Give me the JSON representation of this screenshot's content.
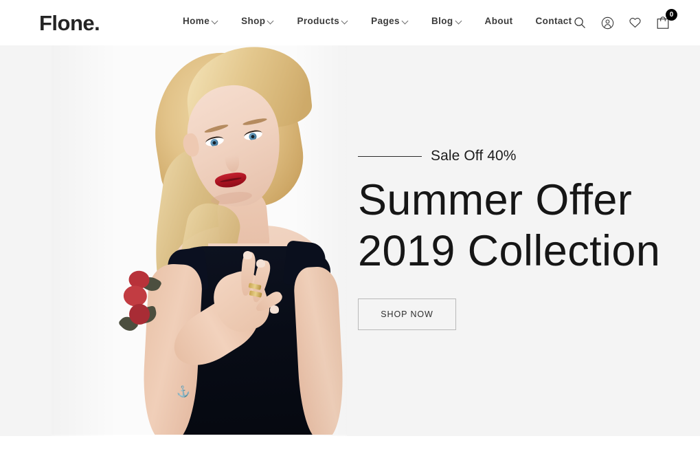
{
  "site": {
    "logo": "Flone.",
    "background_hero": "#f4f4f4",
    "accent": "#000000",
    "text_dark": "#1c1c1c"
  },
  "header": {
    "nav": [
      {
        "label": "Home",
        "has_dropdown": true,
        "caret": "chevron-down-icon"
      },
      {
        "label": "Shop",
        "has_dropdown": true,
        "caret": "chevron-down-icon"
      },
      {
        "label": "Products",
        "has_dropdown": true,
        "caret": "chevron-down-icon"
      },
      {
        "label": "Pages",
        "has_dropdown": true,
        "caret": "chevron-down-icon"
      },
      {
        "label": "Blog",
        "has_dropdown": true,
        "caret": "chevron-down-icon"
      },
      {
        "label": "About",
        "has_dropdown": false,
        "caret": ""
      },
      {
        "label": "Contact",
        "has_dropdown": false,
        "caret": ""
      }
    ],
    "icons": {
      "search": "search-icon",
      "account": "user-account-icon",
      "wishlist": "heart-icon",
      "cart": "shopping-cart-icon"
    },
    "cart_count": "0"
  },
  "hero": {
    "eyebrow": "Sale Off 40%",
    "headline_line1": "Summer Offer",
    "headline_line2": "2019 Collection",
    "cta_label": "SHOP NOW",
    "image_alt": "blonde-model-black-top-peace-sign"
  }
}
